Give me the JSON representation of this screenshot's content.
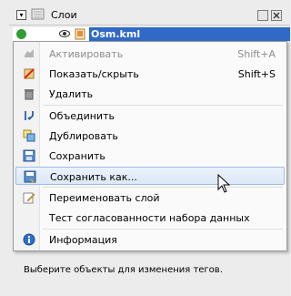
{
  "panel": {
    "title": "Слои",
    "layer_name": "Osm.kml",
    "status": "Выберите объекты для изменения тегов."
  },
  "menu": {
    "items": [
      {
        "label": "Активировать",
        "shortcut": "Shift+A",
        "icon": "activate-icon",
        "disabled": true
      },
      {
        "label": "Показать/скрыть",
        "shortcut": "Shift+S",
        "icon": "show-hide-icon",
        "disabled": false
      },
      {
        "label": "Удалить",
        "shortcut": "",
        "icon": "trash-icon",
        "disabled": false
      },
      {
        "label": "Объединить",
        "shortcut": "",
        "icon": "merge-icon",
        "disabled": false
      },
      {
        "label": "Дублировать",
        "shortcut": "",
        "icon": "duplicate-icon",
        "disabled": false
      },
      {
        "label": "Сохранить",
        "shortcut": "",
        "icon": "save-icon",
        "disabled": false
      },
      {
        "label": "Сохранить как...",
        "shortcut": "",
        "icon": "save-as-icon",
        "disabled": false
      },
      {
        "label": "Переименовать слой",
        "shortcut": "",
        "icon": "rename-icon",
        "disabled": false
      },
      {
        "label": "Тест согласованности набора данных",
        "shortcut": "",
        "icon": "",
        "disabled": false
      },
      {
        "label": "Информация",
        "shortcut": "",
        "icon": "info-icon",
        "disabled": false
      }
    ]
  },
  "colors": {
    "selection": "#3169c6",
    "hover_border": "#9fbde5",
    "check": "#2e9e33"
  }
}
